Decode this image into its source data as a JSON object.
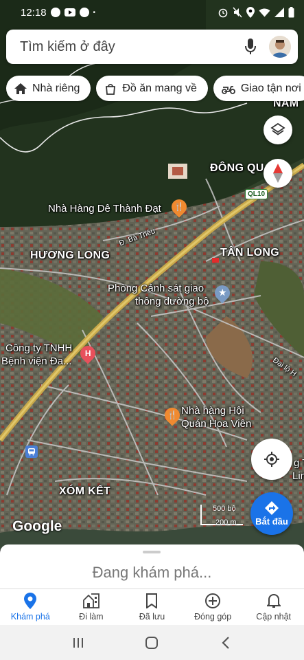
{
  "status_bar": {
    "time": "12:18",
    "left_icons": [
      "facebook-icon",
      "youtube-icon",
      "facebook-icon",
      "dot-icon"
    ],
    "right_icons": [
      "alarm-icon",
      "mute-icon",
      "location-icon",
      "wifi-icon",
      "signal-icon",
      "battery-icon"
    ]
  },
  "search": {
    "placeholder": "Tìm kiếm ở đây",
    "mic_icon": "mic-icon",
    "avatar": "profile-avatar"
  },
  "chips": [
    {
      "label": "Nhà riêng",
      "icon": "home-icon"
    },
    {
      "label": "Đồ ăn mang về",
      "icon": "takeout-bag-icon"
    },
    {
      "label": "Giao tận nơi",
      "icon": "delivery-scooter-icon"
    }
  ],
  "map": {
    "area_labels": {
      "dong_qu": "ĐÔNG QU",
      "huong_long": "HƯƠNG LONG",
      "tan_long": "TÂN LONG",
      "xom_ket": "XÓM KẾT",
      "nam": "NAM"
    },
    "road_labels": {
      "ba_trieu": "Đ. Bà Triệu",
      "dai_lo": "Đại lộ H",
      "ql10": "QL10"
    },
    "poi": {
      "nha_hang_de": "Nhà Hàng Dê Thành Đạt",
      "canh_sat_1": "Phòng Cảnh sát giao",
      "canh_sat_2": "thông đường bộ",
      "cong_ty_1": "Công ty TNHH",
      "cong_ty_2": "Bệnh viện Đa...",
      "hoi_quan_1": "Nhà hàng Hội",
      "hoi_quan_2": "Quán Hoa Viên",
      "right_edge_1": "g T",
      "right_edge_2": "Linh"
    },
    "logo": "Google",
    "scale": {
      "top": "500 bộ",
      "bottom": "200 m"
    }
  },
  "controls": {
    "layers_icon": "layers-icon",
    "compass_icon": "compass-icon",
    "locate_icon": "my-location-icon",
    "directions_label": "Bắt đầu"
  },
  "sheet": {
    "title": "Đang khám phá..."
  },
  "bottom_nav": [
    {
      "label": "Khám phá",
      "icon": "explore-pin-icon",
      "active": true
    },
    {
      "label": "Đi làm",
      "icon": "commute-icon",
      "active": false
    },
    {
      "label": "Đã lưu",
      "icon": "bookmark-icon",
      "active": false
    },
    {
      "label": "Đóng góp",
      "icon": "add-circle-icon",
      "active": false
    },
    {
      "label": "Cập nhật",
      "icon": "bell-icon",
      "active": false
    }
  ],
  "colors": {
    "accent": "#1a73e8",
    "food_pin": "#f08a30",
    "hospital_pin": "#e8505b",
    "highway": "#c9a94a"
  }
}
